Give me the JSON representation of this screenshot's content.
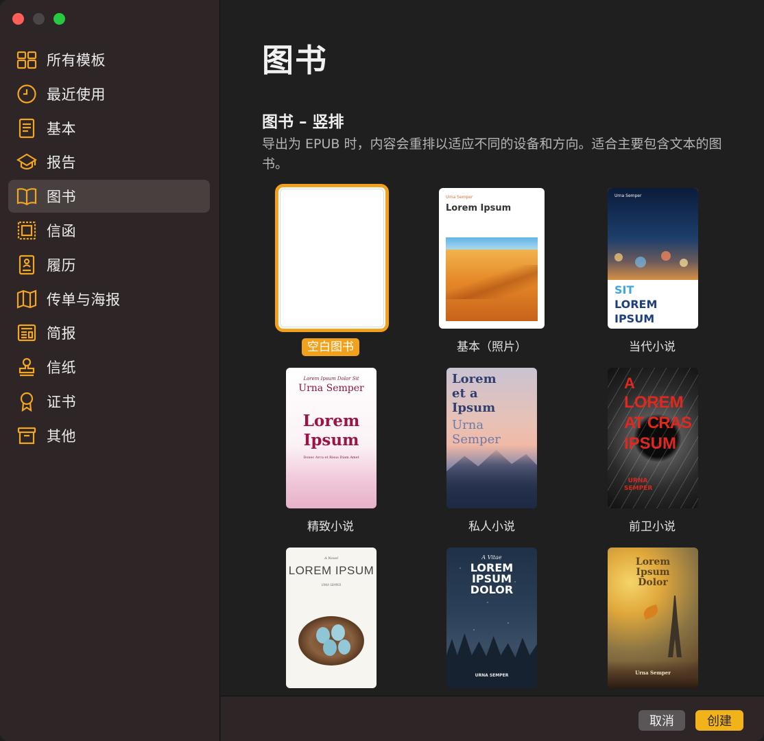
{
  "window": {
    "controls": [
      "close",
      "minimize",
      "zoom"
    ]
  },
  "sidebar": {
    "items": [
      {
        "label": "所有模板",
        "icon": "grid-icon"
      },
      {
        "label": "最近使用",
        "icon": "clock-icon"
      },
      {
        "label": "基本",
        "icon": "document-icon"
      },
      {
        "label": "报告",
        "icon": "graduation-cap-icon"
      },
      {
        "label": "图书",
        "icon": "book-icon",
        "selected": true
      },
      {
        "label": "信函",
        "icon": "stamp-frame-icon"
      },
      {
        "label": "履历",
        "icon": "resume-icon"
      },
      {
        "label": "传单与海报",
        "icon": "map-icon"
      },
      {
        "label": "简报",
        "icon": "newspaper-icon"
      },
      {
        "label": "信纸",
        "icon": "stamp-icon"
      },
      {
        "label": "证书",
        "icon": "ribbon-icon"
      },
      {
        "label": "其他",
        "icon": "archive-box-icon"
      }
    ]
  },
  "main": {
    "title": "图书",
    "section_title": "图书 – 竖排",
    "section_desc": "导出为 EPUB 时，内容会重排以适应不同的设备和方向。适合主要包含文本的图书。",
    "templates": [
      {
        "label": "空白图书",
        "selected": true
      },
      {
        "label": "基本（照片）",
        "cover_small": "Urna Semper",
        "cover_title": "Lorem Ipsum"
      },
      {
        "label": "当代小说",
        "cover_small": "Urna Semper",
        "cover_words": [
          "SIT",
          "LOREM",
          "IPSUM"
        ]
      },
      {
        "label": "精致小说",
        "cover_top": "Lorem Ipsum Dolor Sit",
        "cover_sub": "Urna Semper",
        "cover_title1": "Lorem",
        "cover_title2": "Ipsum",
        "cover_foot": "Donec Arcu et Risus Diam Amet"
      },
      {
        "label": "私人小说",
        "cover_lines": [
          "Lorem",
          "et a",
          "Ipsum"
        ],
        "cover_lines2": [
          "Urna",
          "Semper"
        ]
      },
      {
        "label": "前卫小说",
        "cover_lines": [
          "A",
          "LOREM",
          "AT CRAS",
          "IPSUM"
        ],
        "cover_foot": "URNA SEMPER"
      },
      {
        "label": "",
        "cover_top": "A Novel",
        "cover_title": "LOREM IPSUM",
        "cover_sub": "URNA SEMPER"
      },
      {
        "label": "",
        "cover_top": "A Vitae",
        "cover_lines": [
          "LOREM",
          "IPSUM",
          "DOLOR"
        ],
        "cover_foot": "URNA SEMPER"
      },
      {
        "label": "",
        "cover_lines": [
          "Lorem",
          "Ipsum",
          "Dolor"
        ],
        "cover_foot": "Urna Semper"
      }
    ]
  },
  "footer": {
    "cancel_label": "取消",
    "create_label": "创建"
  },
  "colors": {
    "accent": "#f0a21d",
    "sidebar_bg": "#2d2526",
    "main_bg": "#1f1f1f",
    "selected_row": "#48403f"
  }
}
